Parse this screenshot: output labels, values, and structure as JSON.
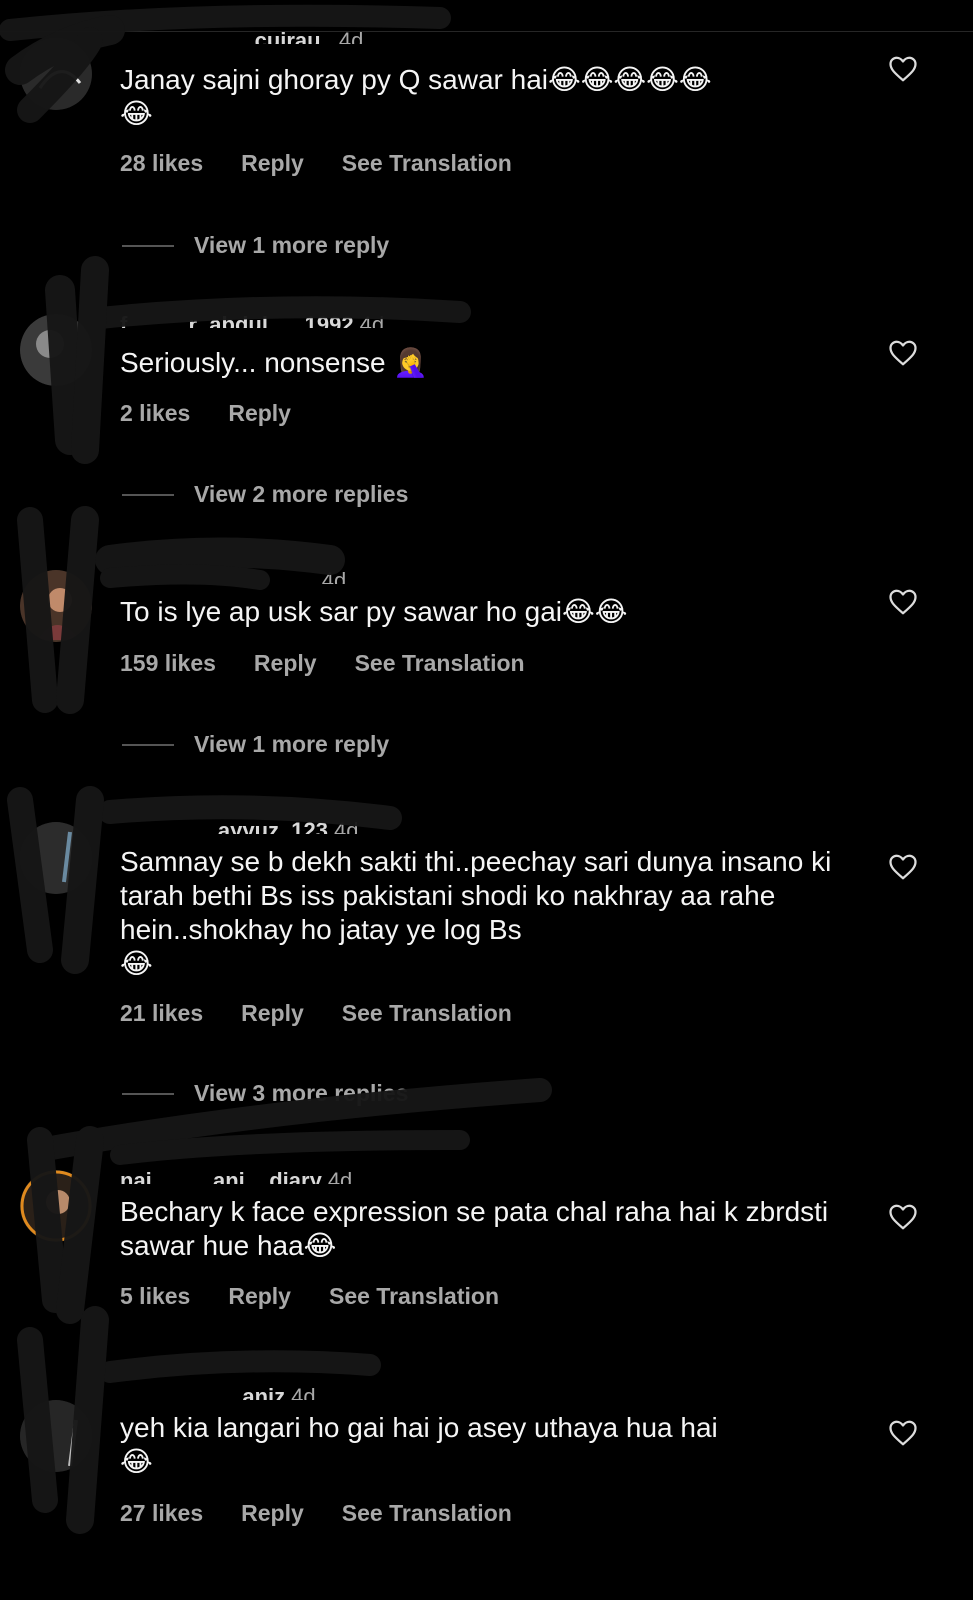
{
  "comments": [
    {
      "username": "___________cuirau_",
      "time": "4d",
      "text": "Janay sajni ghoray py Q sawar hai😂😂😂😂😂\n😂",
      "likes": "28 likes",
      "reply": "Reply",
      "translate": "See Translation",
      "view_replies": "View 1 more reply"
    },
    {
      "username": "f_____r_abdul___1992",
      "time": "4d",
      "text": "Seriously... nonsense 🤦‍♀️",
      "likes": "2 likes",
      "reply": "Reply",
      "translate": "",
      "view_replies": "View 2 more replies"
    },
    {
      "username": "________________",
      "time": "4d",
      "text": "To is lye ap usk sar py sawar ho gai😂😂",
      "likes": "159 likes",
      "reply": "Reply",
      "translate": "See Translation",
      "view_replies": "View 1 more reply"
    },
    {
      "username": "________ayyuz_123",
      "time": "4d",
      "text": "Samnay se b dekh sakti thi..peechay sari dunya insano ki tarah bethi Bs iss pakistani shodi ko nakhray aa rahe hein..shokhay ho jatay ye log Bs\n😂",
      "likes": "21 likes",
      "reply": "Reply",
      "translate": "See Translation",
      "view_replies": "View 3 more replies"
    },
    {
      "username": "nai_____ani__diary",
      "time": "4d",
      "text": "Bechary k face expression se pata chal raha hai k zbrdsti sawar hue haa😂",
      "likes": "5 likes",
      "reply": "Reply",
      "translate": "See Translation",
      "view_replies": ""
    },
    {
      "username": "__________aniz",
      "time": "4d",
      "text": "yeh kia langari ho gai hai jo asey uthaya hua hai\n😂",
      "likes": "27 likes",
      "reply": "Reply",
      "translate": "See Translation",
      "view_replies": ""
    }
  ],
  "icons": {
    "like": "heart-outline-icon"
  },
  "colors": {
    "background": "#000000",
    "primary_text": "#f5f5f5",
    "secondary_text": "#a8a8a8",
    "redaction": "#161616"
  }
}
